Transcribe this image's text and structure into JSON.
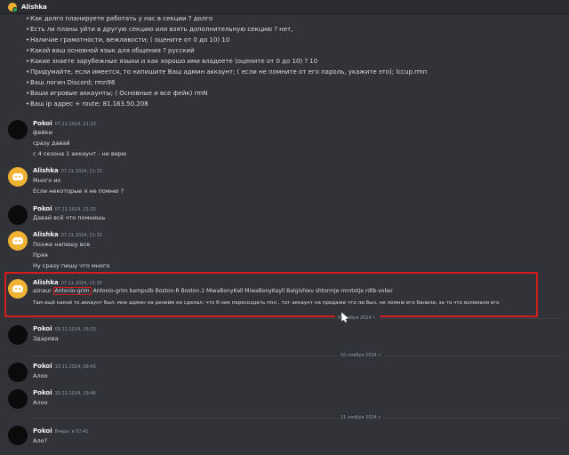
{
  "header": {
    "title": "Alishka"
  },
  "questions": [
    "Как долго планируете работать у нас в секции ? долго",
    "Есть ли планы уйти в другую секцию или взять дополнительную секцию ? нет,",
    "Наличие грамотности, вежливости; ( оцените от 0 до 10) 10",
    "Какой ваш основной язык для общения ? русский",
    "Какие знаете зарубежные языки и как хорошо ими владеете (оцените от 0 до 10) ? 10",
    "Придумайте, если имеется, то напишите Ваш админ аккаунт; ( если не помните от его пароль, укажите это); lccup.rmn",
    "Ваш логин Discord; rmn98",
    "Ваши игровые аккаунты; ( Основные и все фейк) rmN",
    "Ваш ip адрес + route; 81.163.50.208"
  ],
  "messages": [
    {
      "author": "Pokoi",
      "timestamp": "07.11.2024, 21:23",
      "lines": [
        "фейки",
        "сразу давай",
        "с 4 сезона 1 аккаунт - не верю"
      ]
    },
    {
      "author": "Alishka",
      "timestamp": "07.11.2024, 21:31",
      "lines": [
        "Много их",
        "Если некоторые я не помню ?"
      ]
    },
    {
      "author": "Pokoi",
      "timestamp": "07.11.2024, 21:32",
      "lines": [
        "Давай всё что помнишь"
      ]
    },
    {
      "author": "Alishka",
      "timestamp": "07.11.2024, 21:32",
      "lines": [
        "Позже напишу все",
        "Пряя",
        "Ну сразу пишу что много"
      ]
    },
    {
      "author": "Alishka",
      "timestamp": "07.11.2024, 21:35",
      "line1_prefix": "aznaur",
      "line1_highlight": "Antonio-grim",
      "line1_rest": "Antonio-grim bamputb Boston-R Boston.1 MiwaBonyKall MiwaBonyKayll Balgishiev shtormje rmntotje rdtb-voker",
      "line2": "Там ещё какой то аккаунт был, мне админ на ренейм ее сделал, что б ник пересоздать rmn  , тот аккаунт на продаже что ли был, не помню его банили, за то что взломали его"
    },
    {
      "author": "Pokoi",
      "timestamp": "09.11.2024, 16:33",
      "lines": [
        "Здарова"
      ]
    },
    {
      "author": "Pokoi",
      "timestamp": "10.11.2024, 08:43",
      "lines": [
        "Алоо"
      ]
    },
    {
      "author": "Pokoi",
      "timestamp": "10.11.2024, 19:46",
      "lines": [
        "Алоо"
      ]
    },
    {
      "author": "Pokoi",
      "timestamp": "Вчера, в 07:41",
      "lines": [
        "Ало?"
      ]
    }
  ],
  "separators": {
    "nov9": "9 ноября 2024 г.",
    "nov10": "10 ноября 2024 г.",
    "nov11": "11 ноября 2024 г."
  },
  "colors": {
    "highlight": "#d11d1d",
    "alishka_avatar": "#f0b232",
    "background": "#313338"
  }
}
